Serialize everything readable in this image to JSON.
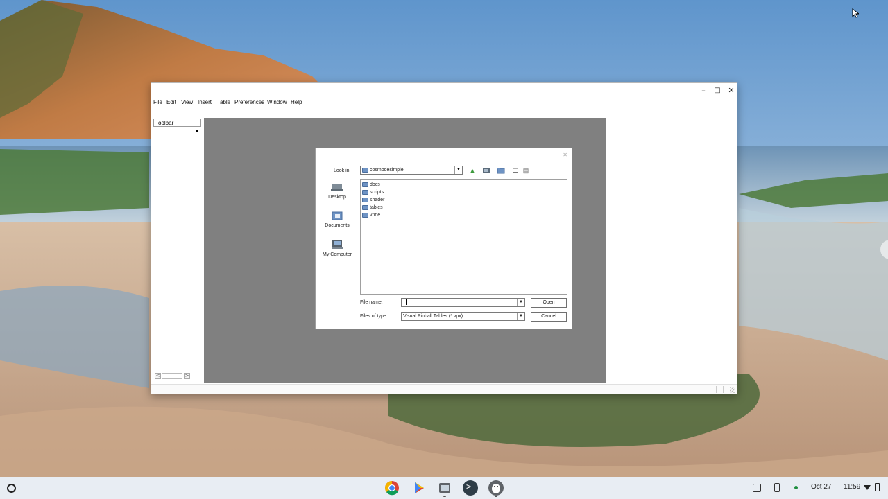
{
  "window": {
    "minimize_glyph": "–",
    "maximize_glyph": "□",
    "close_glyph": "✕",
    "menu": [
      "File",
      "Edit",
      "View",
      "Insert",
      "Table",
      "Preferences",
      "Window",
      "Help"
    ]
  },
  "toolbar_panel": {
    "title": "Toolbar",
    "scroll_left": "<",
    "scroll_right": ">"
  },
  "dialog": {
    "close_glyph": "✕",
    "look_in_label": "Look in:",
    "look_in_value": "cosmodesimple",
    "places": [
      {
        "label": "Desktop",
        "icon": "desktop-icon"
      },
      {
        "label": "Documents",
        "icon": "documents-icon"
      },
      {
        "label": "My Computer",
        "icon": "computer-icon"
      }
    ],
    "files": [
      "docs",
      "scripts",
      "shader",
      "tables",
      "vnne"
    ],
    "file_name_label": "File name:",
    "file_name_value": "",
    "files_of_type_label": "Files of type:",
    "files_of_type_value": "Visual Pinball Tables (*.vpx)",
    "open_button": "Open",
    "cancel_button": "Cancel",
    "toolbar_icons": [
      "up-folder-icon",
      "home-icon",
      "new-folder-icon",
      "list-view-icon",
      "details-view-icon"
    ]
  },
  "shelf": {
    "launcher_icon": "launcher-circle-icon",
    "apps": [
      "chrome-icon",
      "play-store-icon",
      "files-app-icon",
      "terminal-icon",
      "linux-penguin-icon"
    ],
    "date": "Oct 27",
    "time": "11:59",
    "tray_icons": [
      "screen-capture-icon",
      "phone-hub-icon",
      "status-dot-icon",
      "wifi-icon",
      "battery-icon"
    ]
  },
  "colors": {
    "canvas_gray": "#808080",
    "shelf_bg": "#e8edf3",
    "folder_blue": "#6e93c4"
  }
}
